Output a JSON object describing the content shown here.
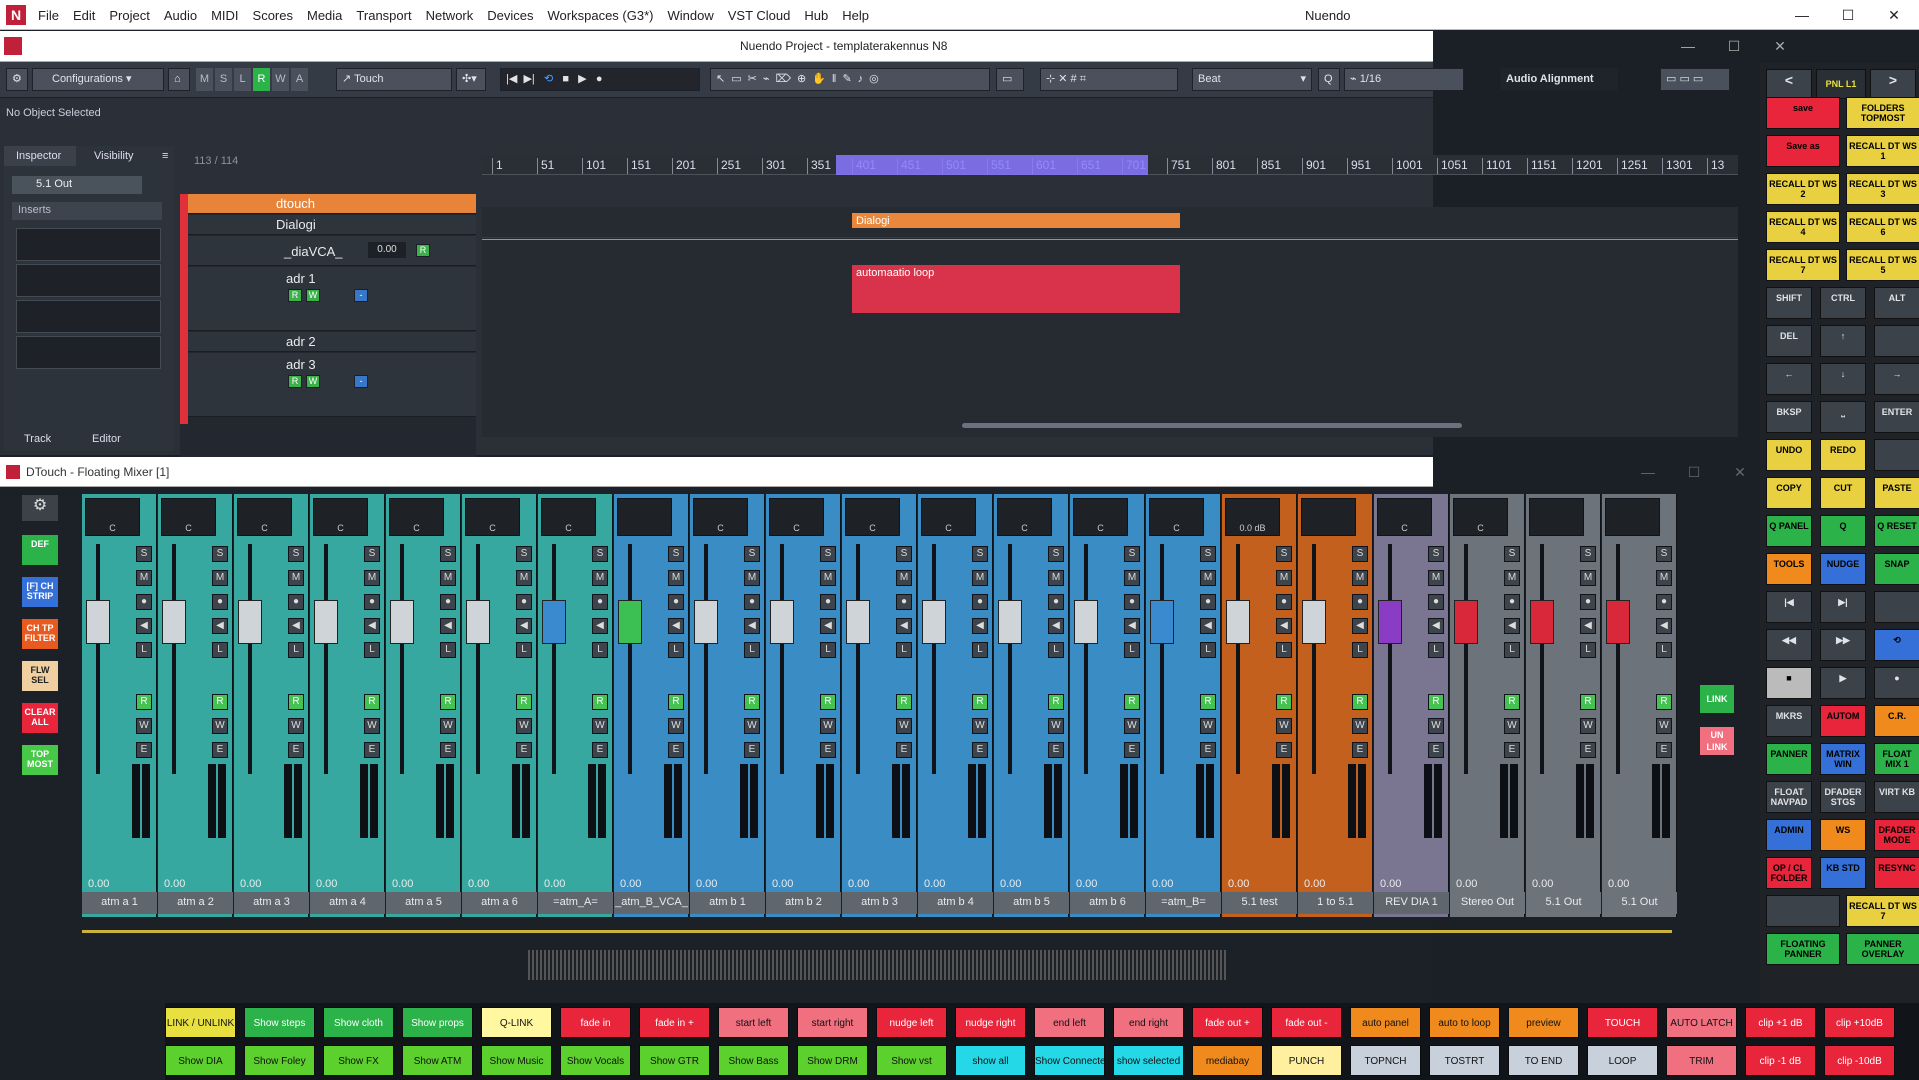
{
  "app": {
    "title": "Nuendo",
    "menu": [
      "File",
      "Edit",
      "Project",
      "Audio",
      "MIDI",
      "Scores",
      "Media",
      "Transport",
      "Network",
      "Devices",
      "Workspaces (G3*)",
      "Window",
      "VST Cloud",
      "Hub",
      "Help"
    ]
  },
  "project": {
    "title": "Nuendo Project - templaterakennus N8",
    "toolbar": {
      "configurations": "Configurations",
      "modes": [
        "M",
        "S",
        "L",
        "R",
        "W",
        "A"
      ],
      "automation_mode": "Touch",
      "grid_type": "Beat",
      "quantize": "1/16",
      "audio_alignment": "Audio Alignment"
    },
    "status": "No Object Selected",
    "inspector": {
      "tabs": [
        "Inspector",
        "Visibility"
      ],
      "output": "5.1 Out",
      "inserts": "Inserts",
      "bottom_tabs": [
        "Track",
        "Editor"
      ]
    },
    "track_count": "113 / 114",
    "tracks": [
      {
        "name": "dtouch"
      },
      {
        "name": "Dialogi"
      },
      {
        "name": "_diaVCA_",
        "value": "0.00"
      },
      {
        "name": "adr 1"
      },
      {
        "name": "adr 2"
      },
      {
        "name": "adr 3"
      }
    ],
    "ruler": [
      "1",
      "51",
      "101",
      "151",
      "201",
      "251",
      "301",
      "351",
      "401",
      "451",
      "501",
      "551",
      "601",
      "651",
      "701",
      "751",
      "801",
      "851",
      "901",
      "951",
      "1001",
      "1051",
      "1101",
      "1151",
      "1201",
      "1251",
      "1301",
      "13"
    ],
    "events": [
      {
        "name": "Dialogi",
        "color": "#e9873c"
      },
      {
        "name": "automaatio loop",
        "color": "#d8334a"
      }
    ]
  },
  "mixer": {
    "title": "DTouch - Floating Mixer [1]",
    "side_buttons": [
      {
        "label": "DEF",
        "color": "#2bb34a"
      },
      {
        "label": "[F] CH STRIP",
        "color": "#3570d8"
      },
      {
        "label": "CH TP FILTER",
        "color": "#e85a1f"
      },
      {
        "label": "FLW SEL",
        "color": "#f0d0a0"
      },
      {
        "label": "CLEAR ALL",
        "color": "#e8253a"
      },
      {
        "label": "TOP MOST",
        "color": "#48c848"
      }
    ],
    "link": "LINK",
    "unlink": "UN LINK",
    "channels": [
      {
        "name": "atm a 1",
        "value": "0.00",
        "color": "#37a8a0",
        "pan": "C",
        "fader": "#cfd4d8"
      },
      {
        "name": "atm a 2",
        "value": "0.00",
        "color": "#37a8a0",
        "pan": "C",
        "fader": "#cfd4d8"
      },
      {
        "name": "atm a 3",
        "value": "0.00",
        "color": "#37a8a0",
        "pan": "C",
        "fader": "#cfd4d8"
      },
      {
        "name": "atm a 4",
        "value": "0.00",
        "color": "#37a8a0",
        "pan": "C",
        "fader": "#cfd4d8"
      },
      {
        "name": "atm a 5",
        "value": "0.00",
        "color": "#37a8a0",
        "pan": "C",
        "fader": "#cfd4d8"
      },
      {
        "name": "atm a 6",
        "value": "0.00",
        "color": "#37a8a0",
        "pan": "C",
        "fader": "#cfd4d8"
      },
      {
        "name": "=atm_A=",
        "value": "0.00",
        "color": "#37a8a0",
        "pan": "C",
        "fader": "#3a8ad0"
      },
      {
        "name": "_atm_B_VCA_",
        "value": "0.00",
        "color": "#3a8cc4",
        "pan": "",
        "fader": "#3cc054"
      },
      {
        "name": "atm b 1",
        "value": "0.00",
        "color": "#3a8cc4",
        "pan": "C",
        "fader": "#cfd4d8"
      },
      {
        "name": "atm b 2",
        "value": "0.00",
        "color": "#3a8cc4",
        "pan": "C",
        "fader": "#cfd4d8"
      },
      {
        "name": "atm b 3",
        "value": "0.00",
        "color": "#3a8cc4",
        "pan": "C",
        "fader": "#cfd4d8"
      },
      {
        "name": "atm b 4",
        "value": "0.00",
        "color": "#3a8cc4",
        "pan": "C",
        "fader": "#cfd4d8"
      },
      {
        "name": "atm b 5",
        "value": "0.00",
        "color": "#3a8cc4",
        "pan": "C",
        "fader": "#cfd4d8"
      },
      {
        "name": "atm b 6",
        "value": "0.00",
        "color": "#3a8cc4",
        "pan": "C",
        "fader": "#cfd4d8"
      },
      {
        "name": "=atm_B=",
        "value": "0.00",
        "color": "#3a8cc4",
        "pan": "C",
        "fader": "#3a8ad0"
      },
      {
        "name": "5.1 test",
        "value": "0.00",
        "color": "#c4601e",
        "pan": "0.0 dB",
        "fader": "#cfd4d8"
      },
      {
        "name": "1 to 5.1",
        "value": "0.00",
        "color": "#c4601e",
        "pan": "",
        "fader": "#cfd4d8"
      },
      {
        "name": "REV DIA 1",
        "value": "0.00",
        "color": "#7a7590",
        "pan": "C",
        "fader": "#8a3cc4"
      },
      {
        "name": "Stereo Out",
        "value": "0.00",
        "color": "#6d737b",
        "pan": "C",
        "fader": "#d8283a"
      },
      {
        "name": "5.1 Out",
        "value": "0.00",
        "color": "#6d737b",
        "pan": "",
        "fader": "#d8283a"
      },
      {
        "name": "5.1 Out",
        "value": "0.00",
        "color": "#6d737b",
        "pan": "",
        "fader": "#d8283a"
      }
    ]
  },
  "panel": {
    "nav": "PNL L1",
    "buttons": [
      {
        "label": "save",
        "color": "#e8253a"
      },
      {
        "label": "FOLDERS TOPMOST",
        "color": "#e8d040"
      },
      {
        "label": "Save as",
        "color": "#e8253a"
      },
      {
        "label": "RECALL DT WS 1",
        "color": "#e8d040"
      },
      {
        "label": "RECALL DT WS 2",
        "color": "#e8d040"
      },
      {
        "label": "RECALL DT WS 3",
        "color": "#e8d040"
      },
      {
        "label": "RECALL DT WS 4",
        "color": "#e8d040"
      },
      {
        "label": "RECALL DT WS 6",
        "color": "#e8d040"
      },
      {
        "label": "RECALL DT WS 7",
        "color": "#e8d040"
      },
      {
        "label": "RECALL DT WS 5",
        "color": "#e8d040"
      },
      {
        "label": "SHIFT",
        "color": "#3c4249"
      },
      {
        "label": "CTRL",
        "color": "#3c4249"
      },
      {
        "label": "ALT",
        "color": "#3c4249"
      },
      {
        "label": "DEL",
        "color": "#3c4249"
      },
      {
        "label": "↑",
        "color": "#3c4249"
      },
      {
        "label": "",
        "color": "#3c4249"
      },
      {
        "label": "←",
        "color": "#3c4249"
      },
      {
        "label": "↓",
        "color": "#3c4249"
      },
      {
        "label": "→",
        "color": "#3c4249"
      },
      {
        "label": "BKSP",
        "color": "#3c4249"
      },
      {
        "label": "⎵",
        "color": "#3c4249"
      },
      {
        "label": "ENTER",
        "color": "#3c4249"
      },
      {
        "label": "UNDO",
        "color": "#e8d040"
      },
      {
        "label": "REDO",
        "color": "#e8d040"
      },
      {
        "label": "",
        "color": "#3c4249"
      },
      {
        "label": "COPY",
        "color": "#e8d040"
      },
      {
        "label": "CUT",
        "color": "#e8d040"
      },
      {
        "label": "PASTE",
        "color": "#e8d040"
      },
      {
        "label": "Q PANEL",
        "color": "#2bb34a"
      },
      {
        "label": "Q",
        "color": "#2bb34a"
      },
      {
        "label": "Q RESET",
        "color": "#2bb34a"
      },
      {
        "label": "TOOLS",
        "color": "#f08a1c"
      },
      {
        "label": "NUDGE",
        "color": "#3570d8"
      },
      {
        "label": "SNAP",
        "color": "#2bb34a"
      },
      {
        "label": "|◀",
        "color": "#3c4249"
      },
      {
        "label": "▶|",
        "color": "#3c4249"
      },
      {
        "label": "",
        "color": "#3c4249"
      },
      {
        "label": "◀◀",
        "color": "#3c4249"
      },
      {
        "label": "▶▶",
        "color": "#3c4249"
      },
      {
        "label": "⟲",
        "color": "#3570d8"
      },
      {
        "label": "■",
        "color": "#bbbbbb"
      },
      {
        "label": "▶",
        "color": "#3c4249"
      },
      {
        "label": "●",
        "color": "#3c4249"
      },
      {
        "label": "MKRS",
        "color": "#3c4249"
      },
      {
        "label": "AUTOM",
        "color": "#e8253a"
      },
      {
        "label": "C.R.",
        "color": "#f08a1c"
      },
      {
        "label": "PANNER",
        "color": "#2bb34a"
      },
      {
        "label": "MATRIX WIN",
        "color": "#3570d8"
      },
      {
        "label": "FLOAT MIX 1",
        "color": "#2bb34a"
      },
      {
        "label": "FLOAT NAVPAD",
        "color": "#3c4249"
      },
      {
        "label": "DFADER STGS",
        "color": "#3c4249"
      },
      {
        "label": "VIRT KB",
        "color": "#3c4249"
      },
      {
        "label": "ADMIN",
        "color": "#3570d8"
      },
      {
        "label": "WS",
        "color": "#f08a1c"
      },
      {
        "label": "DFADER MODE",
        "color": "#e8253a"
      },
      {
        "label": "OP / CL FOLDER",
        "color": "#e8253a"
      },
      {
        "label": "KB STD",
        "color": "#3570d8"
      },
      {
        "label": "RESYNC",
        "color": "#e8253a"
      },
      {
        "label": "",
        "color": "#3c4249"
      },
      {
        "label": "RECALL DT WS 7",
        "color": "#e8d040"
      },
      {
        "label": "FLOATING PANNER",
        "color": "#2bb34a"
      },
      {
        "label": "PANNER OVERLAY",
        "color": "#2bb34a"
      }
    ]
  },
  "grid": {
    "row1": [
      {
        "label": "LINK / UNLINK",
        "color": "#e8e040"
      },
      {
        "label": "Show steps",
        "color": "#2bb34a"
      },
      {
        "label": "Show cloth",
        "color": "#2bb34a"
      },
      {
        "label": "Show props",
        "color": "#2bb34a"
      },
      {
        "label": "Q-LINK",
        "color": "#fff8a0"
      },
      {
        "label": "fade in",
        "color": "#e8253a"
      },
      {
        "label": "fade in +",
        "color": "#e8253a"
      },
      {
        "label": "start left",
        "color": "#f07080"
      },
      {
        "label": "start right",
        "color": "#f07080"
      },
      {
        "label": "nudge left",
        "color": "#e8253a"
      },
      {
        "label": "nudge right",
        "color": "#e8253a"
      },
      {
        "label": "end left",
        "color": "#f07080"
      },
      {
        "label": "end right",
        "color": "#f07080"
      },
      {
        "label": "fade out +",
        "color": "#e8253a"
      },
      {
        "label": "fade out -",
        "color": "#e8253a"
      },
      {
        "label": "auto panel",
        "color": "#f08a1c"
      },
      {
        "label": "auto to loop",
        "color": "#f08a1c"
      },
      {
        "label": "preview",
        "color": "#f08a1c"
      },
      {
        "label": "TOUCH",
        "color": "#e8253a"
      },
      {
        "label": "AUTO LATCH",
        "color": "#f07080"
      },
      {
        "label": "clip +1 dB",
        "color": "#e8253a"
      },
      {
        "label": "clip +10dB",
        "color": "#e8253a"
      }
    ],
    "row2": [
      {
        "label": "Show DIA",
        "color": "#5cd02c"
      },
      {
        "label": "Show Foley",
        "color": "#5cd02c"
      },
      {
        "label": "Show FX",
        "color": "#5cd02c"
      },
      {
        "label": "Show ATM",
        "color": "#5cd02c"
      },
      {
        "label": "Show Music",
        "color": "#5cd02c"
      },
      {
        "label": "Show Vocals",
        "color": "#5cd02c"
      },
      {
        "label": "Show GTR",
        "color": "#5cd02c"
      },
      {
        "label": "Show Bass",
        "color": "#5cd02c"
      },
      {
        "label": "Show DRM",
        "color": "#5cd02c"
      },
      {
        "label": "Show vst",
        "color": "#5cd02c"
      },
      {
        "label": "show all",
        "color": "#24d8e8"
      },
      {
        "label": "Show Connected",
        "color": "#24d8e8"
      },
      {
        "label": "show selected",
        "color": "#24d8e8"
      },
      {
        "label": "mediabay",
        "color": "#f08a1c"
      },
      {
        "label": "PUNCH",
        "color": "#fff0a0"
      },
      {
        "label": "TOPNCH",
        "color": "#c8d0dc"
      },
      {
        "label": "TOSTRT",
        "color": "#c8d0dc"
      },
      {
        "label": "TO END",
        "color": "#c8d0dc"
      },
      {
        "label": "LOOP",
        "color": "#c8d0dc"
      },
      {
        "label": "TRIM",
        "color": "#f07080"
      },
      {
        "label": "clip -1 dB",
        "color": "#e8253a"
      },
      {
        "label": "clip -10dB",
        "color": "#e8253a"
      }
    ]
  }
}
